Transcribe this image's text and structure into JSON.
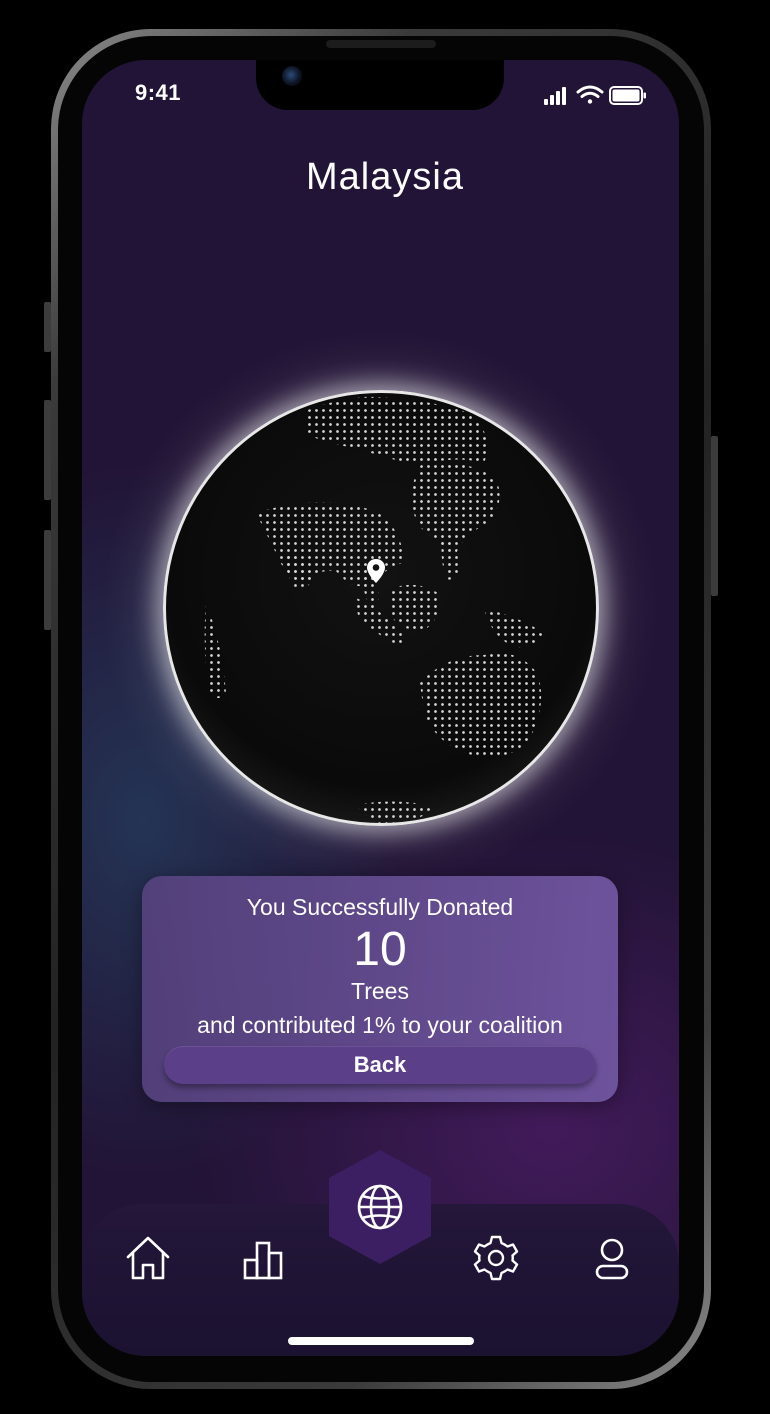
{
  "status_bar": {
    "time": "9:41"
  },
  "header": {
    "title": "Malaysia"
  },
  "globe": {
    "pin_icon": "map-pin-icon"
  },
  "donation": {
    "heading": "You Successfully Donated",
    "count": "10",
    "unit": "Trees",
    "detail": "and contributed 1% to your coalition",
    "back_label": "Back"
  },
  "tab_bar": {
    "items": [
      {
        "icon": "home-icon"
      },
      {
        "icon": "bar-chart-icon"
      },
      {
        "icon": "globe-icon",
        "active": true
      },
      {
        "icon": "gear-icon"
      },
      {
        "icon": "user-icon"
      }
    ]
  },
  "colors": {
    "background": "#221436",
    "card": "#6b52a0",
    "button": "#5b3f88",
    "accent_hex": "#3c1f63",
    "text": "#ffffff"
  }
}
